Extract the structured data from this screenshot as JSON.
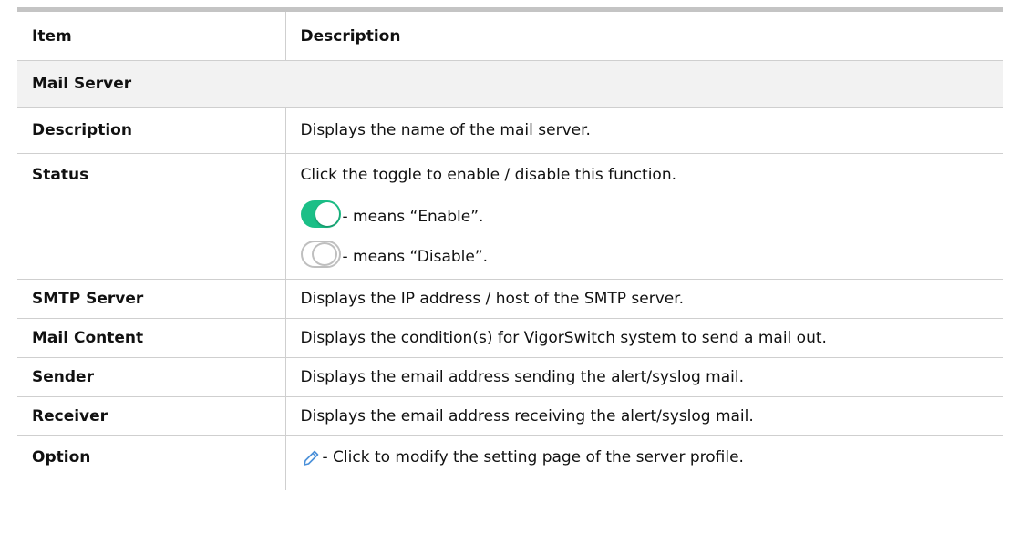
{
  "table": {
    "headers": {
      "item": "Item",
      "description": "Description"
    },
    "section_title": "Mail Server",
    "rows": [
      {
        "item": "Description",
        "description": "Displays the name of the mail server."
      },
      {
        "item": "Status",
        "description": "Click the toggle to enable / disable this function.",
        "enable_text": " - means “Enable”.",
        "disable_text": " - means “Disable”."
      },
      {
        "item": "SMTP Server",
        "description": "Displays the IP address / host of the SMTP server."
      },
      {
        "item": "Mail Content",
        "description": "Displays the condition(s) for VigorSwitch system to send a mail out."
      },
      {
        "item": "Sender",
        "description": "Displays the email address sending the alert/syslog mail."
      },
      {
        "item": "Receiver",
        "description": "Displays the email address receiving the alert/syslog mail."
      },
      {
        "item": "Option",
        "description": " - Click to modify the setting page of the server profile."
      }
    ]
  },
  "icons": {
    "toggle_on": "toggle-on-icon",
    "toggle_off": "toggle-off-icon",
    "edit": "pencil-icon"
  },
  "colors": {
    "toggle_on": "#1bbf87",
    "toggle_off_border": "#bfbfbf",
    "section_bg": "#f2f2f2",
    "header_rule": "#c4c4c4",
    "pencil": "#4a90d9"
  }
}
